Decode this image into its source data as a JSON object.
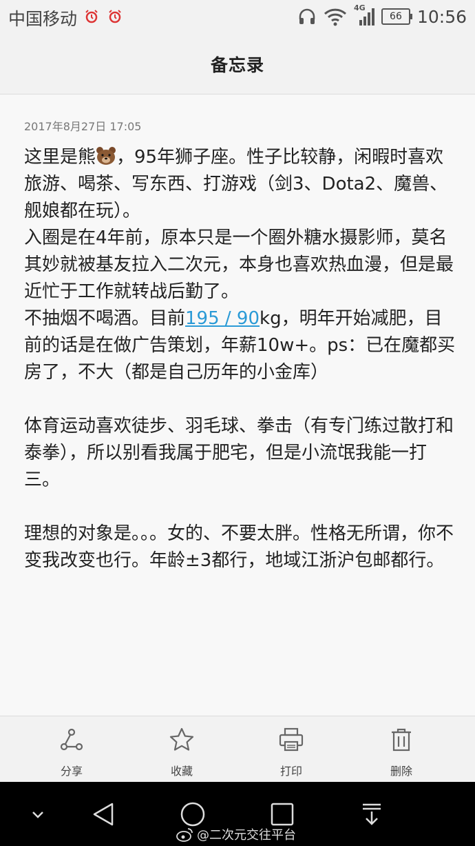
{
  "status_bar": {
    "carrier": "中国移动",
    "network": "4G",
    "battery": "66",
    "time": "10:56"
  },
  "header": {
    "title": "备忘录"
  },
  "note": {
    "timestamp": "2017年8月27日 17:05",
    "p1_before": "这里是熊",
    "p1_after": "，95年狮子座。性子比较静，闲暇时喜欢旅游、喝茶、写东西、打游戏（剑3、Dota2、魔兽、舰娘都在玩）。",
    "p2": "入圈是在4年前，原本只是一个圈外糖水摄影师，莫名其妙就被基友拉入二次元，本身也喜欢热血漫，但是最近忙于工作就转战后勤了。",
    "p3_before": "不抽烟不喝酒。目前",
    "p3_link": "195 / 90",
    "p3_after": "kg，明年开始减肥，目前的话是在做广告策划，年薪10w+。ps：已在魔都买房了，不大（都是自己历年的小金库）",
    "p4": "体育运动喜欢徒步、羽毛球、拳击（有专门练过散打和泰拳），所以别看我属于肥宅，但是小流氓我能一打三。",
    "p5": "理想的对象是。。。女的、不要太胖。性格无所谓，你不变我改变也行。年龄±3都行，地域江浙沪包邮都行。"
  },
  "toolbar": {
    "share_label": "分享",
    "favorite_label": "收藏",
    "print_label": "打印",
    "delete_label": "删除"
  },
  "watermark": "@二次元交往平台",
  "colors": {
    "link": "#2a9ad6",
    "navbar": "#000000",
    "background": "#f8f8f8"
  }
}
